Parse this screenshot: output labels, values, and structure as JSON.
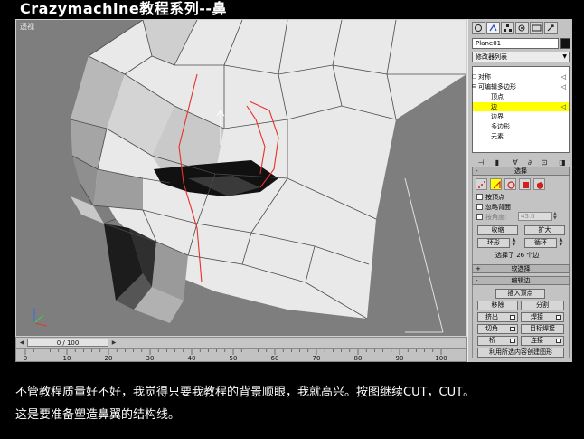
{
  "title": "Crazymachine教程系列--鼻",
  "viewport": {
    "label": "透视"
  },
  "timeline": {
    "slider_text": "0 / 100",
    "ruler_ticks": [
      "0",
      "10",
      "20",
      "30",
      "40",
      "50",
      "60",
      "70",
      "80",
      "90",
      "100"
    ]
  },
  "panel": {
    "object_name": "Plane01",
    "modifier_list": "修改器列表",
    "stack": [
      {
        "label": "对称",
        "indent": 0,
        "selected": false,
        "marker": "▢"
      },
      {
        "label": "可编辑多边形",
        "indent": 0,
        "selected": false,
        "marker": "⊟"
      },
      {
        "label": "顶点",
        "indent": 1,
        "selected": false,
        "marker": ""
      },
      {
        "label": "边",
        "indent": 1,
        "selected": true,
        "marker": ""
      },
      {
        "label": "边界",
        "indent": 1,
        "selected": false,
        "marker": ""
      },
      {
        "label": "多边形",
        "indent": 1,
        "selected": false,
        "marker": ""
      },
      {
        "label": "元素",
        "indent": 1,
        "selected": false,
        "marker": ""
      }
    ],
    "selection": {
      "header": "选择",
      "by_vertex": "按顶点",
      "ignore_backfacing": "忽略背面",
      "by_angle": "按角度:",
      "angle_value": "45.0",
      "shrink": "收缩",
      "grow": "扩大",
      "ring": "环形",
      "loop": "循环",
      "status": "选择了 26 个边"
    },
    "soft_selection": {
      "header": "软选择"
    },
    "edit_edges": {
      "header": "编辑边",
      "insert_vertex": "插入顶点",
      "remove": "移除",
      "split": "分割",
      "extrude": "挤出",
      "weld": "焊接",
      "chamfer": "切角",
      "target_weld": "目标焊接",
      "bridge": "桥",
      "connect": "连接",
      "create_shape": "利用所选内容创建图形"
    }
  },
  "caption": {
    "line1": "不管教程质量好不好，我觉得只要我教程的背景顺眼，我就高兴。按图继续CUT，CUT。",
    "line2": "这是要准备塑造鼻翼的结构线。"
  },
  "colors": {
    "selected_edge": "#e8302a",
    "highlight": "#ffff00",
    "viewport_bg": "#7e7e7e"
  }
}
